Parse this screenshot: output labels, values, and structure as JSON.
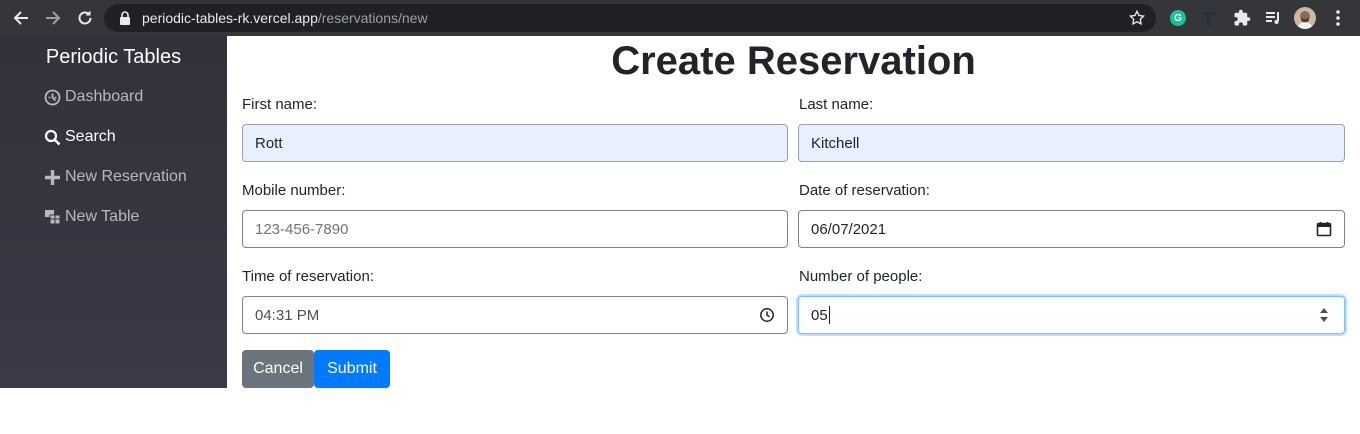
{
  "browser": {
    "url_host": "periodic-tables-rk.vercel.app",
    "url_path": "/reservations/new",
    "grammarly_letter": "G"
  },
  "sidebar": {
    "brand": "Periodic Tables",
    "items": [
      {
        "label": "Dashboard",
        "icon": "dashboard-icon"
      },
      {
        "label": "Search",
        "icon": "search-icon"
      },
      {
        "label": "New Reservation",
        "icon": "plus-icon"
      },
      {
        "label": "New Table",
        "icon": "table-icon"
      }
    ]
  },
  "form": {
    "title": "Create Reservation",
    "first_name": {
      "label": "First name:",
      "value": "Rott"
    },
    "last_name": {
      "label": "Last name:",
      "value": "Kitchell"
    },
    "mobile": {
      "label": "Mobile number:",
      "placeholder": "123-456-7890"
    },
    "date": {
      "label": "Date of reservation:",
      "value": "06/07/2021"
    },
    "time": {
      "label": "Time of reservation:",
      "value": "04:31 PM"
    },
    "people": {
      "label": "Number of people:",
      "value": "05"
    },
    "cancel_label": "Cancel",
    "submit_label": "Submit"
  },
  "colors": {
    "sidebar_bg": "#35353f",
    "cancel": "#6c757d",
    "submit": "#007bff",
    "autofill": "#e8f0fe"
  }
}
